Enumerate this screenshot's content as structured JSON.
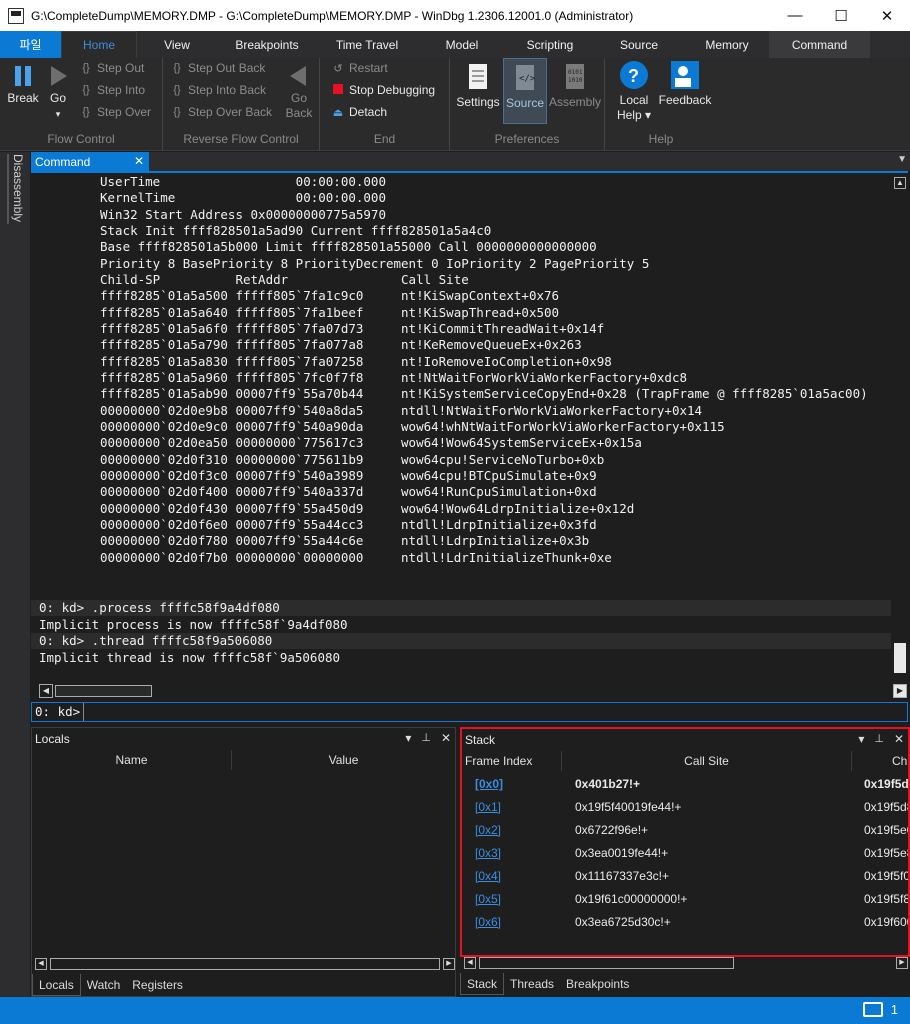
{
  "window": {
    "title": "G:\\CompleteDump\\MEMORY.DMP - G:\\CompleteDump\\MEMORY.DMP - WinDbg 1.2306.12001.0 (Administrator)",
    "minimize": "—",
    "maximize": "☐",
    "close": "✕"
  },
  "ribbon_tabs": [
    "파일",
    "Home",
    "View",
    "Breakpoints",
    "Time Travel",
    "Model",
    "Scripting",
    "Source",
    "Memory",
    "Command"
  ],
  "ribbon": {
    "break_label": "Break",
    "go_label": "Go",
    "go_arrow": "▾",
    "step_out": "Step Out",
    "step_into": "Step Into",
    "step_over": "Step Over",
    "flow_control": "Flow Control",
    "step_out_back": "Step Out Back",
    "step_into_back": "Step Into Back",
    "step_over_back": "Step Over Back",
    "go_back_1": "Go",
    "go_back_2": "Back",
    "reverse_flow_control": "Reverse Flow Control",
    "restart": "Restart",
    "stop_debugging": "Stop Debugging",
    "detach": "Detach",
    "end": "End",
    "settings": "Settings",
    "source": "Source",
    "assembly": "Assembly",
    "preferences": "Preferences",
    "local_help_1": "Local",
    "local_help_2": "Help ▾",
    "feedback": "Feedback",
    "help": "Help"
  },
  "side_tab": "Disassembly",
  "command_tab": {
    "label": "Command",
    "close": "✕",
    "menu": "▼"
  },
  "command_output": {
    "thread_block": [
      "UserTime                  00:00:00.000",
      "KernelTime                00:00:00.000",
      "Win32 Start Address 0x00000000775a5970",
      "Stack Init ffff828501a5ad90 Current ffff828501a5a4c0",
      "Base ffff828501a5b000 Limit ffff828501a55000 Call 0000000000000000",
      "Priority 8 BasePriority 8 PriorityDecrement 0 IoPriority 2 PagePriority 5",
      "Child-SP          RetAddr               Call Site",
      "ffff8285`01a5a500 fffff805`7fa1c9c0     nt!KiSwapContext+0x76",
      "ffff8285`01a5a640 fffff805`7fa1beef     nt!KiSwapThread+0x500",
      "ffff8285`01a5a6f0 fffff805`7fa07d73     nt!KiCommitThreadWait+0x14f",
      "ffff8285`01a5a790 fffff805`7fa077a8     nt!KeRemoveQueueEx+0x263",
      "ffff8285`01a5a830 fffff805`7fa07258     nt!IoRemoveIoCompletion+0x98",
      "ffff8285`01a5a960 fffff805`7fc0f7f8     nt!NtWaitForWorkViaWorkerFactory+0xdc8",
      "ffff8285`01a5ab90 00007ff9`55a70b44     nt!KiSystemServiceCopyEnd+0x28 (TrapFrame @ ffff8285`01a5ac00)",
      "00000000`02d0e9b8 00007ff9`540a8da5     ntdll!NtWaitForWorkViaWorkerFactory+0x14",
      "00000000`02d0e9c0 00007ff9`540a90da     wow64!whNtWaitForWorkViaWorkerFactory+0x115",
      "00000000`02d0ea50 00000000`775617c3     wow64!Wow64SystemServiceEx+0x15a",
      "00000000`02d0f310 00000000`775611b9     wow64cpu!ServiceNoTurbo+0xb",
      "00000000`02d0f3c0 00007ff9`540a3989     wow64cpu!BTCpuSimulate+0x9",
      "00000000`02d0f400 00007ff9`540a337d     wow64!RunCpuSimulation+0xd",
      "00000000`02d0f430 00007ff9`55a450d9     wow64!Wow64LdrpInitialize+0x12d",
      "00000000`02d0f6e0 00007ff9`55a44cc3     ntdll!LdrpInitialize+0x3fd",
      "00000000`02d0f780 00007ff9`55a44c6e     ntdll!LdrpInitialize+0x3b",
      "00000000`02d0f7b0 00000000`00000000     ntdll!LdrInitializeThunk+0xe"
    ],
    "cmd1": "0: kd> .process ffffc58f9a4df080",
    "res1": "Implicit process is now ffffc58f`9a4df080",
    "cmd2": "0: kd> .thread ffffc58f9a506080",
    "res2": "Implicit thread is now ffffc58f`9a506080"
  },
  "prompt": {
    "label": "0: kd>",
    "value": ""
  },
  "locals": {
    "title": "Locals",
    "dropdown": "▾",
    "pin": "📌",
    "close": "✕",
    "columns": [
      "Name",
      "Value"
    ],
    "tabs": [
      "Locals",
      "Watch",
      "Registers"
    ]
  },
  "stack": {
    "title": "Stack",
    "dropdown": "▾",
    "pin": "📌",
    "close": "✕",
    "columns": [
      "Frame Index",
      "Call Site",
      "Chi"
    ],
    "rows": [
      {
        "idx": "[0x0]",
        "call_site": "0x401b27!+",
        "child": "0x19f5d"
      },
      {
        "idx": "[0x1]",
        "call_site": "0x19f5f40019fe44!+",
        "child": "0x19f5d8"
      },
      {
        "idx": "[0x2]",
        "call_site": "0x6722f96e!+",
        "child": "0x19f5e0"
      },
      {
        "idx": "[0x3]",
        "call_site": "0x3ea0019fe44!+",
        "child": "0x19f5e8"
      },
      {
        "idx": "[0x4]",
        "call_site": "0x11167337e3c!+",
        "child": "0x19f5f0"
      },
      {
        "idx": "[0x5]",
        "call_site": "0x19f61c00000000!+",
        "child": "0x19f5f8"
      },
      {
        "idx": "[0x6]",
        "call_site": "0x3ea6725d30c!+",
        "child": "0x19f600"
      }
    ],
    "tabs": [
      "Stack",
      "Threads",
      "Breakpoints"
    ]
  },
  "status": {
    "notifications": "1"
  },
  "colors": {
    "accent": "#0a7ad4",
    "highlight_border": "#e81123",
    "link": "#3b8ee0"
  }
}
